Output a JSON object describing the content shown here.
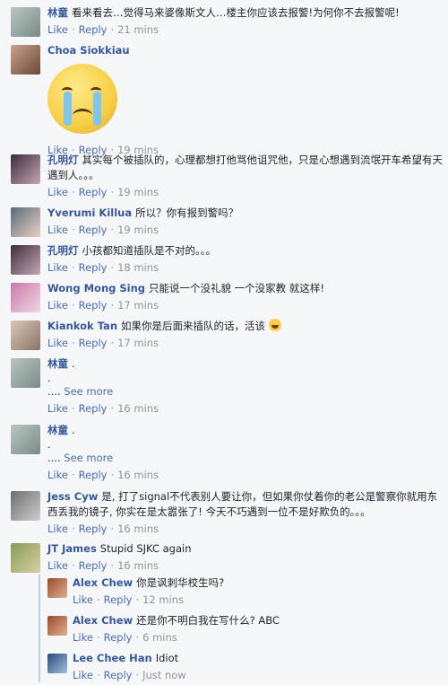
{
  "actions": {
    "like": "Like",
    "reply": "Reply"
  },
  "see_more": "See more",
  "comments": [
    {
      "author": "林童",
      "text": "看来看去…觉得马来婆像斯文人…楼主你应该去报警!为何你不去报警呢!",
      "time": "21 mins",
      "avatar_colors": [
        "#b7c7c0",
        "#7a8a86"
      ]
    },
    {
      "author": "Choa Siokkiau",
      "text": "",
      "time": "19 mins",
      "sticker": "crying-face",
      "avatar_colors": [
        "#c9a28a",
        "#6b4a3a"
      ]
    },
    {
      "author": "孔明灯",
      "text": "其实每个被插队的，心理都想打他骂他诅咒他，只是心想遇到流氓开车希望有天遇到人。。。",
      "time": "19 mins",
      "avatar_colors": [
        "#3a2f3a",
        "#c7a6b3"
      ]
    },
    {
      "author": "Yverumi Killua",
      "text": "所以？你有报到警吗？",
      "time": "19 mins",
      "avatar_colors": [
        "#5b6a7a",
        "#e7d0c4"
      ]
    },
    {
      "author": "孔明灯",
      "text": "小孩都知道插队是不对的。。。",
      "time": "18 mins",
      "avatar_colors": [
        "#3a2f3a",
        "#c7a6b3"
      ]
    },
    {
      "author": "Wong Mong Sing",
      "text": "只能说一个没礼貌 一个没家教 就这样!",
      "time": "17 mins",
      "avatar_colors": [
        "#c87aa8",
        "#f2d6e4"
      ]
    },
    {
      "author": "Kiankok Tan",
      "text": "如果你是后面来插队的话，活该",
      "time": "17 mins",
      "avatar_colors": [
        "#d9c7b8",
        "#8b7364"
      ]
    },
    {
      "author": "林童",
      "text": ".",
      "extra_lines": [
        "."
      ],
      "time": "16 mins",
      "avatar_colors": [
        "#b7c7c0",
        "#7a8a86"
      ]
    },
    {
      "author": "林童",
      "text": ".",
      "extra_lines": [
        "."
      ],
      "time": "16 mins",
      "avatar_colors": [
        "#b7c7c0",
        "#7a8a86"
      ]
    },
    {
      "author": "Jess Cyw",
      "text": "是, 打了signal不代表别人要让你，但如果你仗着你的老公是警察你就用东西丢我的镜子, 你实在是太嚣张了!  今天不巧遇到一位不是好欺负的。。。",
      "time": "16 mins",
      "avatar_colors": [
        "#6e6e6e",
        "#cfcfcf"
      ]
    },
    {
      "author": "JT James",
      "text": "Stupid SJKC again",
      "time": "16 mins",
      "avatar_colors": [
        "#8a9a5b",
        "#d6d0a0"
      ]
    }
  ],
  "replies": [
    {
      "author": "Alex Chew",
      "text": "你是讽刺华校生吗?",
      "time": "12 mins",
      "avatar_colors": [
        "#9a4a2a",
        "#e0b090"
      ]
    },
    {
      "author": "Alex Chew",
      "text": "还是你不明白我在写什么? ABC",
      "time": "6 mins",
      "avatar_colors": [
        "#9a4a2a",
        "#e0b090"
      ]
    },
    {
      "author": "Lee Chee Han",
      "text": "Idiot",
      "time": "Just now",
      "avatar_colors": [
        "#2a4a7a",
        "#a0c0e0"
      ]
    }
  ]
}
